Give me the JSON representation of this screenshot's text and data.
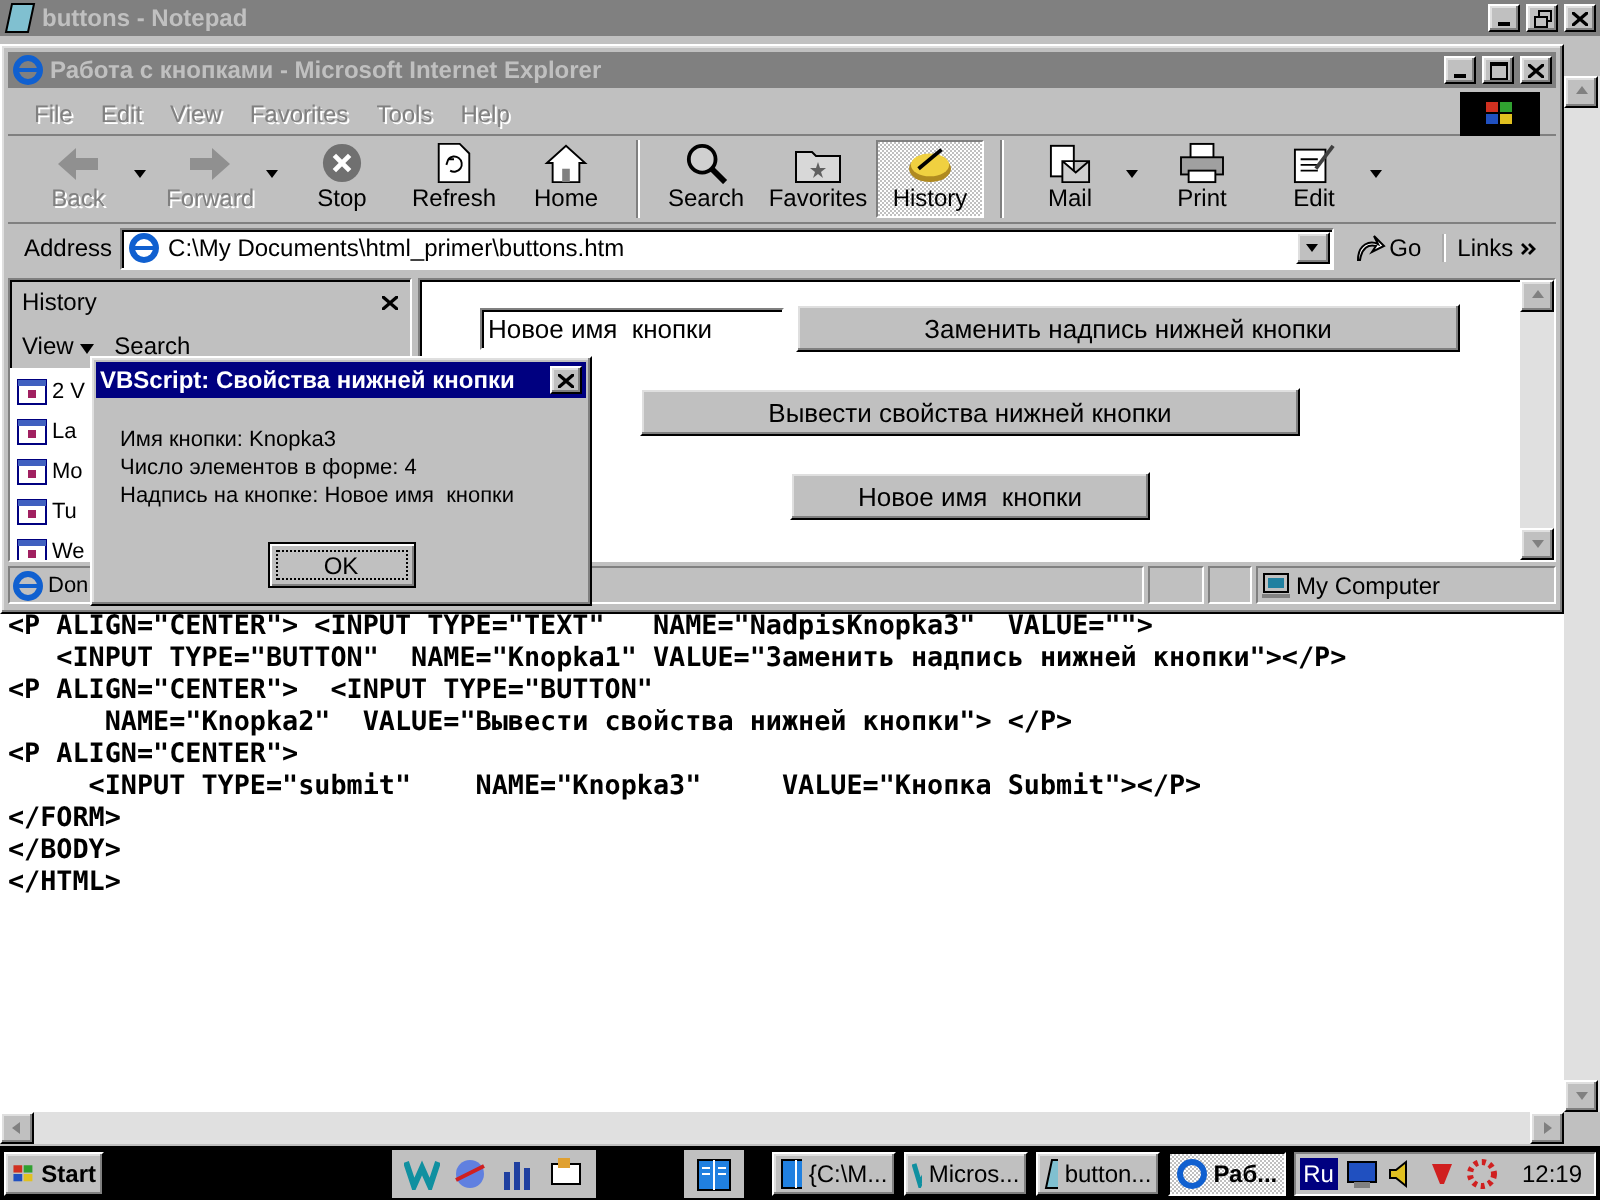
{
  "notepad": {
    "title": "buttons - Notepad",
    "lines": [
      "<P ALIGN=\"CENTER\"> <INPUT TYPE=\"TEXT\"   NAME=\"NadpisKnopka3\"  VALUE=\"\">",
      "   <INPUT TYPE=\"BUTTON\"  NAME=\"Knopka1\" VALUE=\"Заменить надпись нижней кнопки\"></P>",
      "<P ALIGN=\"CENTER\">  <INPUT TYPE=\"BUTTON\"",
      "      NAME=\"Knopka2\"  VALUE=\"Вывести свойства нижней кнопки\"> </P>",
      "<P ALIGN=\"CENTER\">",
      "     <INPUT TYPE=\"submit\"    NAME=\"Knopka3\"     VALUE=\"Кнопка Submit\"></P>",
      "</FORM>",
      "</BODY>",
      "</HTML>"
    ]
  },
  "browser": {
    "title": "Работа с кнопками - Microsoft Internet Explorer",
    "menu": [
      "File",
      "Edit",
      "View",
      "Favorites",
      "Tools",
      "Help"
    ],
    "toolbar": [
      {
        "label": "Back",
        "disabled": true,
        "selected": false,
        "dropdown": true
      },
      {
        "label": "Forward",
        "disabled": true,
        "selected": false,
        "dropdown": true
      },
      {
        "label": "Stop",
        "disabled": false,
        "selected": false,
        "dropdown": false
      },
      {
        "label": "Refresh",
        "disabled": false,
        "selected": false,
        "dropdown": false
      },
      {
        "label": "Home",
        "disabled": false,
        "selected": false,
        "dropdown": false
      },
      {
        "label": "Search",
        "disabled": false,
        "selected": false,
        "dropdown": false
      },
      {
        "label": "Favorites",
        "disabled": false,
        "selected": false,
        "dropdown": false
      },
      {
        "label": "History",
        "disabled": false,
        "selected": true,
        "dropdown": false
      },
      {
        "label": "Mail",
        "disabled": false,
        "selected": false,
        "dropdown": true
      },
      {
        "label": "Print",
        "disabled": false,
        "selected": false,
        "dropdown": false
      },
      {
        "label": "Edit",
        "disabled": false,
        "selected": false,
        "dropdown": true
      }
    ],
    "address": {
      "label": "Address",
      "value": "C:\\My Documents\\html_primer\\buttons.htm"
    },
    "go": "Go",
    "links": "Links",
    "history": {
      "title": "History",
      "view": "View",
      "search": "Search",
      "items": [
        "2 V",
        "La",
        "Mo",
        "Tu",
        "We"
      ]
    },
    "page": {
      "input_value": "Новое имя  кнопки",
      "buttons": [
        "Заменить надпись нижней кнопки",
        "Вывести свойства нижней кнопки",
        "Новое имя  кнопки"
      ]
    },
    "status": {
      "text": "Don",
      "zone": "My Computer"
    }
  },
  "dialog": {
    "title": "VBScript: Свойства нижней кнопки",
    "lines": [
      "Имя кнопки: Knopka3",
      "Число элементов в форме: 4",
      "Надпись на кнопке: Новое имя  кнопки"
    ],
    "button": "OK"
  },
  "taskbar": {
    "start": "Start",
    "tasks": [
      {
        "label": "{C:\\M...",
        "selected": false
      },
      {
        "label": "Micros...",
        "selected": false
      },
      {
        "label": "button...",
        "selected": false
      },
      {
        "label": "Раб...",
        "selected": true
      }
    ],
    "language": "Ru",
    "clock": "12:19"
  }
}
